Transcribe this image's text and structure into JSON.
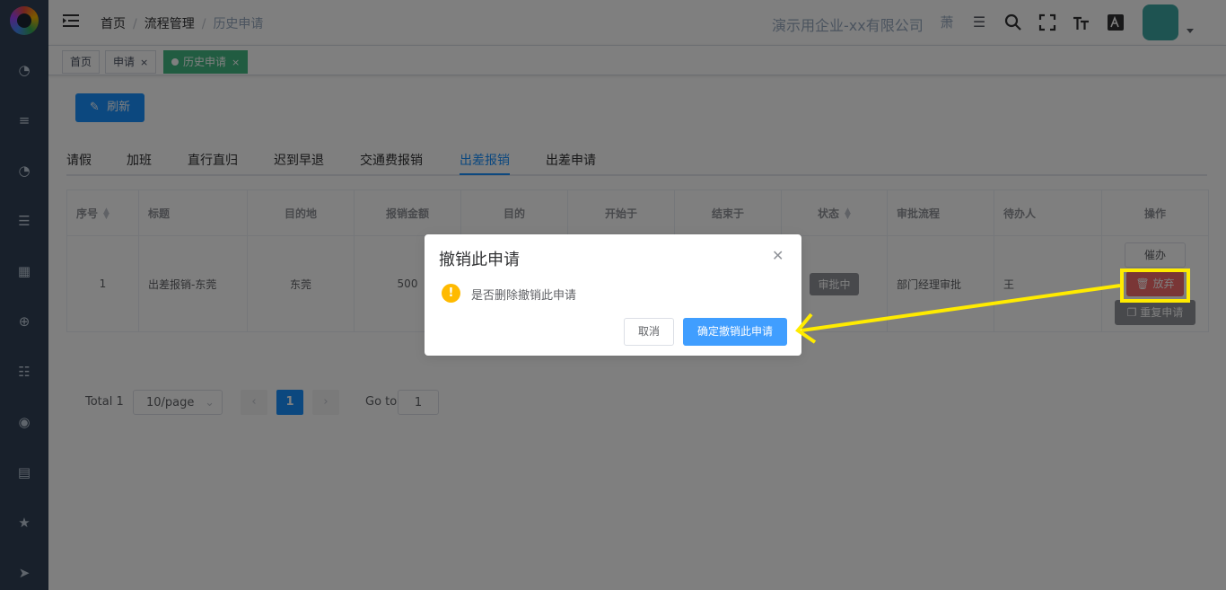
{
  "header": {
    "breadcrumb": [
      "首页",
      "流程管理",
      "历史申请"
    ],
    "company": "演示用企业-xx有限公司",
    "user_initial": "萧"
  },
  "tags": [
    {
      "label": "首页"
    },
    {
      "label": "申请"
    },
    {
      "label": "历史申请"
    }
  ],
  "toolbar": {
    "refresh": "刷新"
  },
  "tabs": [
    "请假",
    "加班",
    "直行直归",
    "迟到早退",
    "交通费报销",
    "出差报销",
    "出差申请"
  ],
  "active_tab": "出差报销",
  "table": {
    "headers": [
      "序号",
      "标题",
      "目的地",
      "报销金额",
      "目的",
      "开始于",
      "结束于",
      "状态",
      "审批流程",
      "待办人",
      "操作"
    ],
    "row": {
      "index": "1",
      "title": "出差报销-东莞",
      "destination": "东莞",
      "amount": "500",
      "status": "审批中",
      "flow": "部门经理审批",
      "assignee": "王"
    },
    "actions": {
      "urge": "催办",
      "abandon": "放弃",
      "resubmit": "重复申请"
    }
  },
  "pagination": {
    "total": "Total 1",
    "page_size": "10/page",
    "current": "1",
    "goto_label": "Go to",
    "goto_value": "1"
  },
  "dialog": {
    "title": "撤销此申请",
    "message": "是否删除撤销此申请",
    "cancel": "取消",
    "confirm": "确定撤销此申请"
  },
  "colors": {
    "sidebar": "#304156",
    "primary": "#1890ff",
    "danger": "#f56c6c",
    "tag_active": "#42b983",
    "annotation": "#ffeb00"
  }
}
